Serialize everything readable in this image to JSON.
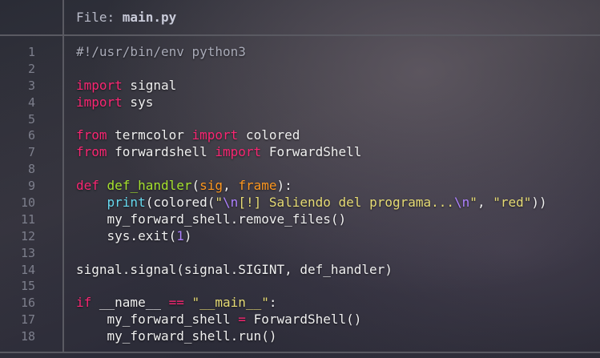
{
  "file_label": "File: ",
  "file_name": "main.py",
  "colors": {
    "keyword": "#f92672",
    "function": "#a6e22e",
    "parameter": "#fd971f",
    "builtin": "#66d9ef",
    "string": "#e6db74",
    "escape": "#ae81ff",
    "number": "#ae81ff",
    "comment": "#a9abb8",
    "line_number": "#7d7f8c"
  },
  "lines": [
    {
      "number": "1",
      "tokens": [
        {
          "t": "comment",
          "v": "#!/usr/bin/env python3"
        }
      ]
    },
    {
      "number": "2",
      "tokens": []
    },
    {
      "number": "3",
      "tokens": [
        {
          "t": "kw",
          "v": "import"
        },
        {
          "t": "plain",
          "v": " signal"
        }
      ]
    },
    {
      "number": "4",
      "tokens": [
        {
          "t": "kw",
          "v": "import"
        },
        {
          "t": "plain",
          "v": " sys"
        }
      ]
    },
    {
      "number": "5",
      "tokens": []
    },
    {
      "number": "6",
      "tokens": [
        {
          "t": "kw",
          "v": "from"
        },
        {
          "t": "plain",
          "v": " termcolor "
        },
        {
          "t": "kw",
          "v": "import"
        },
        {
          "t": "plain",
          "v": " colored"
        }
      ]
    },
    {
      "number": "7",
      "tokens": [
        {
          "t": "kw",
          "v": "from"
        },
        {
          "t": "plain",
          "v": " forwardshell "
        },
        {
          "t": "kw",
          "v": "import"
        },
        {
          "t": "plain",
          "v": " ForwardShell"
        }
      ]
    },
    {
      "number": "8",
      "tokens": []
    },
    {
      "number": "9",
      "tokens": [
        {
          "t": "kw",
          "v": "def"
        },
        {
          "t": "plain",
          "v": " "
        },
        {
          "t": "fn",
          "v": "def_handler"
        },
        {
          "t": "plain",
          "v": "("
        },
        {
          "t": "param",
          "v": "sig"
        },
        {
          "t": "plain",
          "v": ", "
        },
        {
          "t": "param",
          "v": "frame"
        },
        {
          "t": "plain",
          "v": "):"
        }
      ]
    },
    {
      "number": "10",
      "tokens": [
        {
          "t": "plain",
          "v": "    "
        },
        {
          "t": "builtin",
          "v": "print"
        },
        {
          "t": "plain",
          "v": "(colored("
        },
        {
          "t": "str",
          "v": "\""
        },
        {
          "t": "esc",
          "v": "\\n"
        },
        {
          "t": "str",
          "v": "[!] Saliendo del programa..."
        },
        {
          "t": "esc",
          "v": "\\n"
        },
        {
          "t": "str",
          "v": "\""
        },
        {
          "t": "plain",
          "v": ", "
        },
        {
          "t": "str",
          "v": "\"red\""
        },
        {
          "t": "plain",
          "v": "))"
        }
      ]
    },
    {
      "number": "11",
      "tokens": [
        {
          "t": "plain",
          "v": "    my_forward_shell.remove_files()"
        }
      ]
    },
    {
      "number": "12",
      "tokens": [
        {
          "t": "plain",
          "v": "    sys.exit("
        },
        {
          "t": "num",
          "v": "1"
        },
        {
          "t": "plain",
          "v": ")"
        }
      ]
    },
    {
      "number": "13",
      "tokens": []
    },
    {
      "number": "14",
      "tokens": [
        {
          "t": "plain",
          "v": "signal.signal(signal.SIGINT, def_handler)"
        }
      ]
    },
    {
      "number": "15",
      "tokens": []
    },
    {
      "number": "16",
      "tokens": [
        {
          "t": "kw",
          "v": "if"
        },
        {
          "t": "plain",
          "v": " __name__ "
        },
        {
          "t": "op",
          "v": "=="
        },
        {
          "t": "plain",
          "v": " "
        },
        {
          "t": "str",
          "v": "\"__main__\""
        },
        {
          "t": "plain",
          "v": ":"
        }
      ]
    },
    {
      "number": "17",
      "tokens": [
        {
          "t": "plain",
          "v": "    my_forward_shell "
        },
        {
          "t": "op",
          "v": "="
        },
        {
          "t": "plain",
          "v": " ForwardShell()"
        }
      ]
    },
    {
      "number": "18",
      "tokens": [
        {
          "t": "plain",
          "v": "    my_forward_shell.run()"
        }
      ]
    }
  ]
}
